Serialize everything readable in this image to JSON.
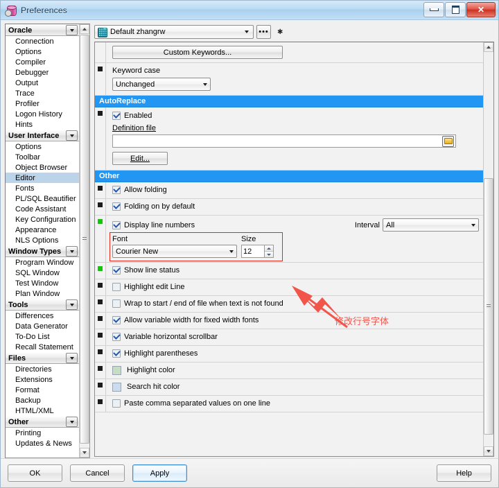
{
  "window": {
    "title": "Preferences",
    "icon": "database-gear-icon",
    "controls": {
      "minimize": "–",
      "maximize": "□",
      "close": "✕"
    }
  },
  "sidebar": {
    "groups": [
      {
        "name": "Oracle",
        "items": [
          "Connection",
          "Options",
          "Compiler",
          "Debugger",
          "Output",
          "Trace",
          "Profiler",
          "Logon History",
          "Hints"
        ]
      },
      {
        "name": "User Interface",
        "items": [
          "Options",
          "Toolbar",
          "Object Browser",
          "Editor",
          "Fonts",
          "PL/SQL Beautifier",
          "Code Assistant",
          "Key Configuration",
          "Appearance",
          "NLS Options"
        ],
        "selected": "Editor"
      },
      {
        "name": "Window Types",
        "items": [
          "Program Window",
          "SQL Window",
          "Test Window",
          "Plan Window"
        ]
      },
      {
        "name": "Tools",
        "items": [
          "Differences",
          "Data Generator",
          "To-Do List",
          "Recall Statement"
        ]
      },
      {
        "name": "Files",
        "items": [
          "Directories",
          "Extensions",
          "Format",
          "Backup",
          "HTML/XML"
        ]
      },
      {
        "name": "Other",
        "items": [
          "Printing",
          "Updates & News"
        ]
      }
    ]
  },
  "toolbar": {
    "profile_value": "Default zhangrw",
    "profile_icon": "db-profile-icon",
    "more_button": "•••",
    "star": "✱"
  },
  "options": {
    "custom_keywords_button": "Custom Keywords...",
    "keyword_case": {
      "label": "Keyword case",
      "value": "Unchanged"
    },
    "sections": {
      "autoreplace": "AutoReplace",
      "other": "Other"
    },
    "autoreplace": {
      "enabled_label": "Enabled",
      "enabled_checked": true,
      "definition_file_label": "Definition file",
      "definition_file_value": "",
      "browse_icon": "folder-open-icon",
      "edit_button": "Edit..."
    },
    "rows": [
      {
        "label": "Allow folding",
        "checked": true,
        "marker": "black"
      },
      {
        "label": "Folding on by default",
        "checked": true,
        "marker": "black"
      },
      {
        "label": "Display line numbers",
        "checked": true,
        "marker": "green"
      },
      {
        "label": "Show line status",
        "checked": true,
        "marker": "green"
      },
      {
        "label": "Highlight edit Line",
        "checked": false,
        "marker": "black"
      },
      {
        "label": "Wrap to start / end of file when text is not found",
        "checked": false,
        "marker": "black"
      },
      {
        "label": "Allow variable width for fixed width fonts",
        "checked": true,
        "marker": "black"
      },
      {
        "label": "Variable horizontal scrollbar",
        "checked": true,
        "marker": "black"
      },
      {
        "label": "Highlight parentheses",
        "checked": true,
        "marker": "black"
      },
      {
        "label": "Highlight color",
        "swatch": "#c5dec3",
        "marker": "black"
      },
      {
        "label": "Search hit color",
        "swatch": "#ccdcf0",
        "marker": "black"
      },
      {
        "label": "Paste comma separated values on one line",
        "checked": false,
        "marker": "black"
      }
    ],
    "interval": {
      "label": "Interval",
      "value": "All"
    },
    "font": {
      "label": "Font",
      "value": "Courier New"
    },
    "size": {
      "label": "Size",
      "value": "12"
    }
  },
  "annotation": {
    "text": "修改行号字体",
    "color": "#f2554a"
  },
  "footer": {
    "ok": "OK",
    "cancel": "Cancel",
    "apply": "Apply",
    "help": "Help"
  },
  "colors": {
    "section_header": "#2196f3",
    "selection": "#bcd4ea",
    "marker_changed": "#16c40d",
    "annotation": "#e8271a"
  }
}
